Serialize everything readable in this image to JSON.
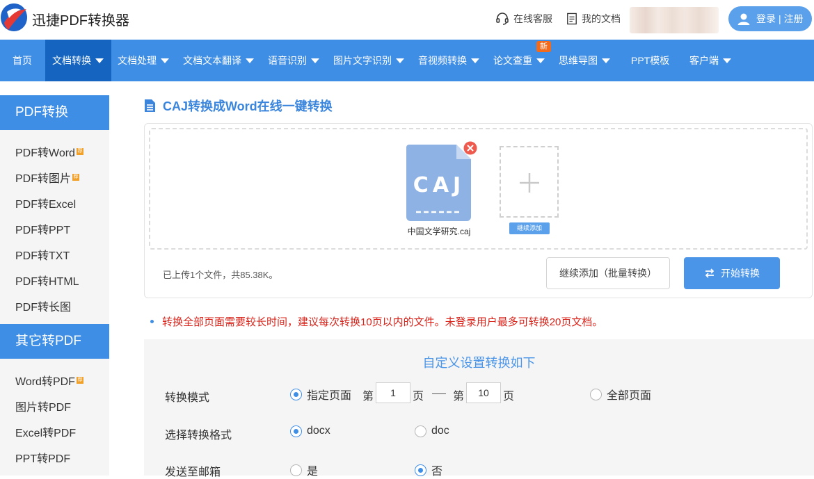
{
  "header": {
    "brand": "迅捷PDF转换器",
    "service_label": "在线客服",
    "docs_label": "我的文档",
    "login_label": "登录",
    "register_label": "注册",
    "login_sep": "|"
  },
  "nav": {
    "items": [
      {
        "label": "首页",
        "caret": false
      },
      {
        "label": "文档转换",
        "caret": true,
        "active": true
      },
      {
        "label": "文档处理",
        "caret": true
      },
      {
        "label": "文档文本翻译",
        "caret": true
      },
      {
        "label": "语音识别",
        "caret": true
      },
      {
        "label": "图片文字识别",
        "caret": true
      },
      {
        "label": "音视频转换",
        "caret": true
      },
      {
        "label": "论文查重",
        "caret": true
      },
      {
        "label": "思维导图",
        "caret": true
      },
      {
        "label": "PPT模板",
        "caret": false
      },
      {
        "label": "客户端",
        "caret": true
      }
    ],
    "new_badge": "新"
  },
  "sidebar": {
    "sections": [
      {
        "title": "PDF转换",
        "items": [
          {
            "label": "PDF转Word",
            "hot": true
          },
          {
            "label": "PDF转图片",
            "hot": true
          },
          {
            "label": "PDF转Excel",
            "hot": false
          },
          {
            "label": "PDF转PPT",
            "hot": false
          },
          {
            "label": "PDF转TXT",
            "hot": false
          },
          {
            "label": "PDF转HTML",
            "hot": false
          },
          {
            "label": "PDF转长图",
            "hot": false
          }
        ]
      },
      {
        "title": "其它转PDF",
        "items": [
          {
            "label": "Word转PDF",
            "hot": true
          },
          {
            "label": "图片转PDF",
            "hot": false
          },
          {
            "label": "Excel转PDF",
            "hot": false
          },
          {
            "label": "PPT转PDF",
            "hot": false
          }
        ]
      }
    ],
    "hot_mark": "荐"
  },
  "main": {
    "title": "CAJ转换成Word在线一键转换",
    "file": {
      "type_label": "CAJ",
      "name": "中国文学研究.caj"
    },
    "add_tag": "继续添加",
    "upload_status": "已上传1个文件，共85.38K。",
    "batch_button": "继续添加（批量转换）",
    "start_button": "开始转换",
    "notice": "转换全部页面需要较长时间，建议每次转换10页以内的文件。未登录用户最多可转换20页文档。"
  },
  "settings": {
    "title": "自定义设置转换如下",
    "mode": {
      "label": "转换模式",
      "specified_label": "指定页面",
      "from_prefix": "第",
      "from_value": "1",
      "from_suffix": "页",
      "to_prefix": "第",
      "to_value": "10",
      "to_suffix": "页",
      "all_label": "全部页面",
      "selected": "指定页面"
    },
    "format": {
      "label": "选择转换格式",
      "options": [
        "docx",
        "doc"
      ],
      "selected": "docx"
    },
    "email": {
      "label": "发送至邮箱",
      "options": [
        "是",
        "否"
      ],
      "selected": "否"
    }
  },
  "colors": {
    "accent": "#3f8ee6",
    "nav_active": "#1565c0",
    "notice": "#d8231a",
    "badge": "#f26a1b"
  }
}
